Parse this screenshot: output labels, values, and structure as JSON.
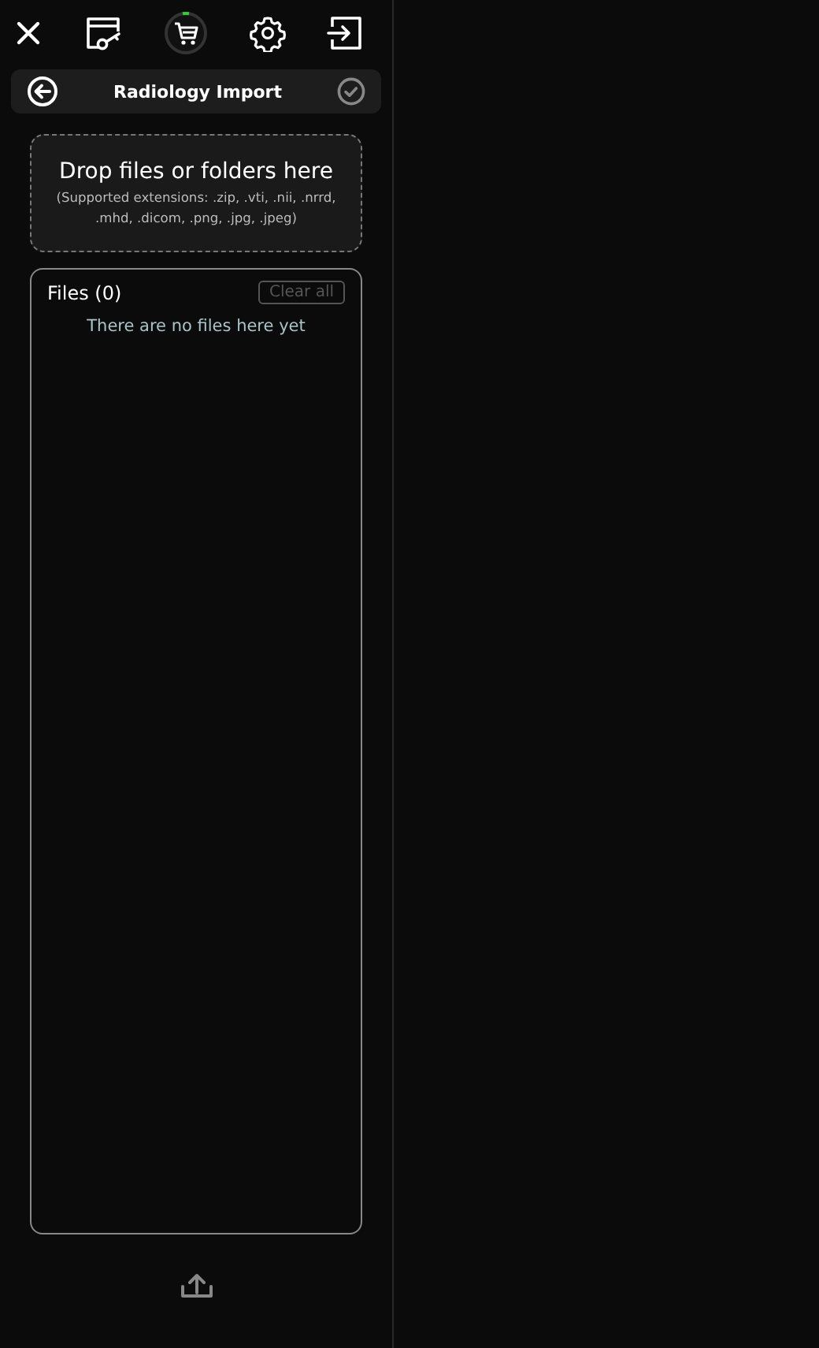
{
  "panel": {
    "title": "Radiology Import"
  },
  "dropzone": {
    "title": "Drop files or folders here",
    "hint": "(Supported extensions: .zip, .vti, .nii, .nrrd, .mhd, .dicom, .png, .jpg, .jpeg)"
  },
  "files": {
    "title": "Files (0)",
    "clear_button": {
      "label": "Clear all",
      "disabled": true
    },
    "empty_message": "There are no files here yet"
  },
  "upload": {
    "disabled": true
  }
}
